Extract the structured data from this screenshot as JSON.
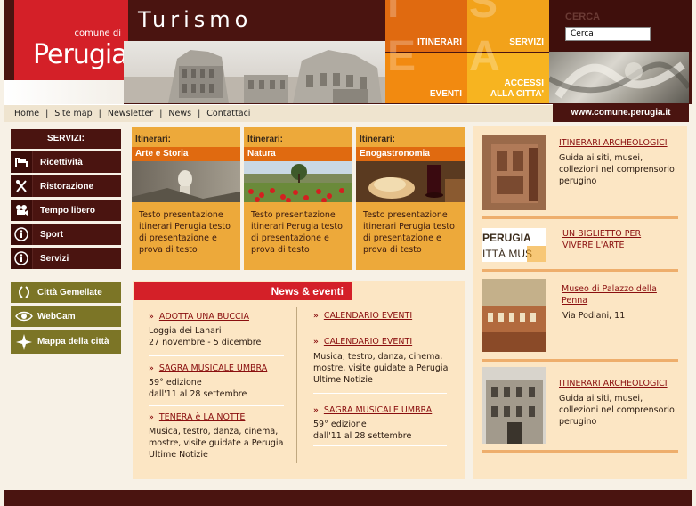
{
  "header": {
    "logo_small": "comune di",
    "logo_big": "Perugia",
    "title": "Turismo",
    "tiles": [
      {
        "label": "ITINERARI",
        "letter": "I",
        "color": "#e06a10"
      },
      {
        "label": "SERVIZI",
        "letter": "S",
        "color": "#f2a21a"
      },
      {
        "label": "EVENTI",
        "letter": "E",
        "color": "#f28a10"
      },
      {
        "label": "ACCESSI ALLA CITTA'",
        "letter": "A",
        "color": "#f7b420"
      }
    ],
    "search_label": "CERCA",
    "search_value": "Cerca",
    "site_url": "www.comune.perugia.it"
  },
  "toplinks": [
    "Home",
    "Site map",
    "Newsletter",
    "News",
    "Contattaci"
  ],
  "sidebar": {
    "heading": "SERVIZI:",
    "items": [
      {
        "label": "Ricettività",
        "icon": "bed-icon"
      },
      {
        "label": "Ristorazione",
        "icon": "fork-knife-icon"
      },
      {
        "label": "Tempo libero",
        "icon": "camera-icon"
      },
      {
        "label": "Sport",
        "icon": "info-icon"
      },
      {
        "label": "Servizi",
        "icon": "info-icon"
      }
    ],
    "extra": [
      {
        "label": "Città Gemellate",
        "icon": "brackets-icon"
      },
      {
        "label": "WebCam",
        "icon": "eye-icon"
      },
      {
        "label": "Mappa della città",
        "icon": "compass-icon"
      }
    ]
  },
  "cards": [
    {
      "kicker": "Itinerari:",
      "heading": "Arte e Storia",
      "text": "Testo presentazione itinerari Perugia testo di presentazione e prova di testo"
    },
    {
      "kicker": "Itinerari:",
      "heading": "Natura",
      "text": "Testo presentazione itinerari Perugia testo di presentazione e prova di testo"
    },
    {
      "kicker": "Itinerari:",
      "heading": "Enogastronomia",
      "text": "Testo presentazione itinerari Perugia testo di presentazione e prova di testo"
    }
  ],
  "news": {
    "title": "News & eventi",
    "left": [
      {
        "link": "ADOTTA UNA BUCCIA",
        "lines": [
          "Loggia dei Lanari",
          "27 novembre - 5 dicembre"
        ]
      },
      {
        "link": "SAGRA MUSICALE UMBRA",
        "lines": [
          "59° edizione",
          "dall'11 al 28 settembre"
        ]
      },
      {
        "link": "TENERA è LA NOTTE",
        "lines": [
          "Musica, testro, danza, cinema,",
          "mostre, visite guidate a Perugia",
          "Ultime Notizie"
        ]
      }
    ],
    "right": [
      {
        "link": "CALENDARIO EVENTI",
        "lines": []
      },
      {
        "link": "CALENDARIO EVENTI",
        "lines": [
          "Musica, testro, danza, cinema,",
          "mostre, visite guidate a Perugia",
          "Ultime Notizie"
        ]
      },
      {
        "link": "SAGRA MUSICALE UMBRA",
        "lines": [
          "59° edizione",
          "dall'11 al 28 settembre"
        ]
      }
    ]
  },
  "right": [
    {
      "title": "ITINERARI ARCHEOLOGICI",
      "lines": [
        "Guida ai siti, musei,",
        "collezioni nel comprensorio",
        "perugino"
      ]
    },
    {
      "title": "UN BIGLIETTO PER VIVERE L'ARTE",
      "lines": [],
      "logo_top": "PERUGIA",
      "logo_bottom": "ITTÀ MUS"
    },
    {
      "title": "Museo di Palazzo della Penna",
      "lines": [
        "Via Podiani, 11"
      ]
    },
    {
      "title": "ITINERARI ARCHEOLOGICI",
      "lines": [
        "Guida ai siti, musei,",
        "collezioni nel comprensorio",
        "perugino"
      ]
    }
  ]
}
